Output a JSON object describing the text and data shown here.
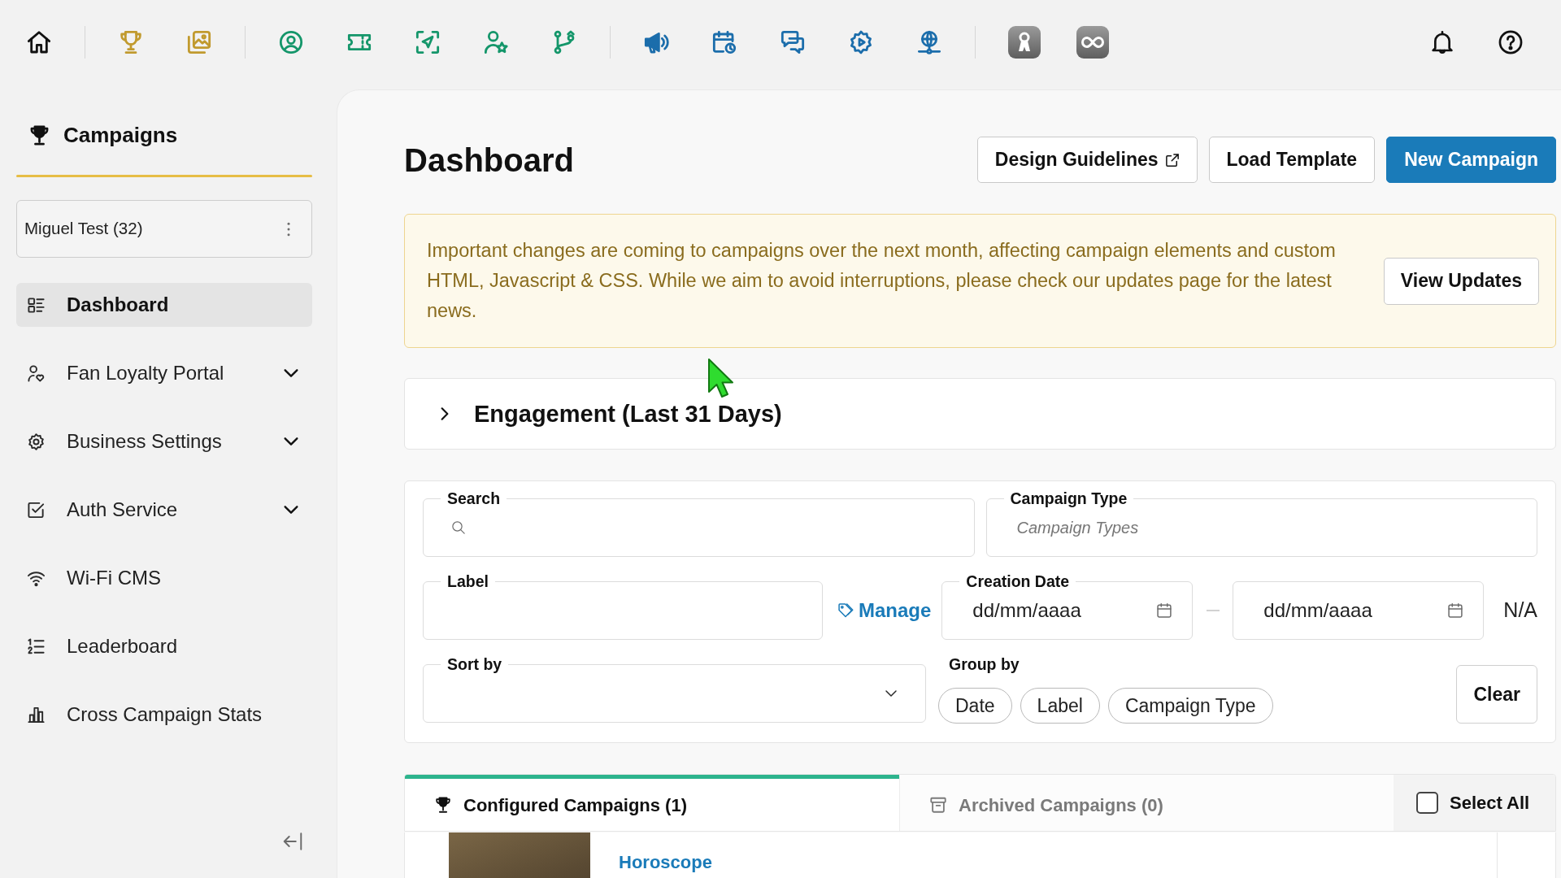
{
  "sidebar": {
    "title": "Campaigns",
    "account": "Miguel Test (32)",
    "items": [
      {
        "label": "Dashboard",
        "selected": true,
        "expandable": false
      },
      {
        "label": "Fan Loyalty Portal",
        "selected": false,
        "expandable": true
      },
      {
        "label": "Business Settings",
        "selected": false,
        "expandable": true
      },
      {
        "label": "Auth Service",
        "selected": false,
        "expandable": true
      },
      {
        "label": "Wi-Fi CMS",
        "selected": false,
        "expandable": false
      },
      {
        "label": "Leaderboard",
        "selected": false,
        "expandable": false
      },
      {
        "label": "Cross Campaign Stats",
        "selected": false,
        "expandable": false
      }
    ]
  },
  "header": {
    "title": "Dashboard",
    "buttons": [
      {
        "label": "Design Guidelines",
        "kind": "external"
      },
      {
        "label": "Load Template",
        "kind": "outline"
      },
      {
        "label": "New Campaign",
        "kind": "primary"
      }
    ]
  },
  "notice": {
    "text": "Important changes are coming to campaigns over the next month, affecting campaign elements and custom HTML, Javascript & CSS. While we aim to avoid interruptions, please check our updates page for the latest news.",
    "button": "View Updates"
  },
  "engagement": {
    "title": "Engagement (Last 31 Days)",
    "expanded": false
  },
  "filters": {
    "search": {
      "label": "Search"
    },
    "campaign_type": {
      "label": "Campaign Type",
      "placeholder": "Campaign Types"
    },
    "label": {
      "label": "Label"
    },
    "manage_link": "Manage",
    "creation_date": {
      "label": "Creation Date",
      "from": {
        "placeholder": "dd/mm/aaaa"
      },
      "to": {
        "placeholder": "dd/mm/aaaa"
      },
      "range": "N/A"
    },
    "sort_by": {
      "label": "Sort by"
    },
    "group_by": {
      "label": "Group by",
      "options": [
        {
          "label": "Date",
          "selected": false
        },
        {
          "label": "Label",
          "selected": false
        },
        {
          "label": "Campaign Type",
          "selected": false
        }
      ]
    },
    "clear_button": "Clear"
  },
  "tabs": [
    {
      "label": "Configured Campaigns (1)",
      "selected": true
    },
    {
      "label": "Archived Campaigns (0)",
      "selected": false
    }
  ],
  "select_all": {
    "label": "Select All",
    "checked": false
  },
  "campaigns": [
    {
      "name": "Horoscope"
    }
  ]
}
